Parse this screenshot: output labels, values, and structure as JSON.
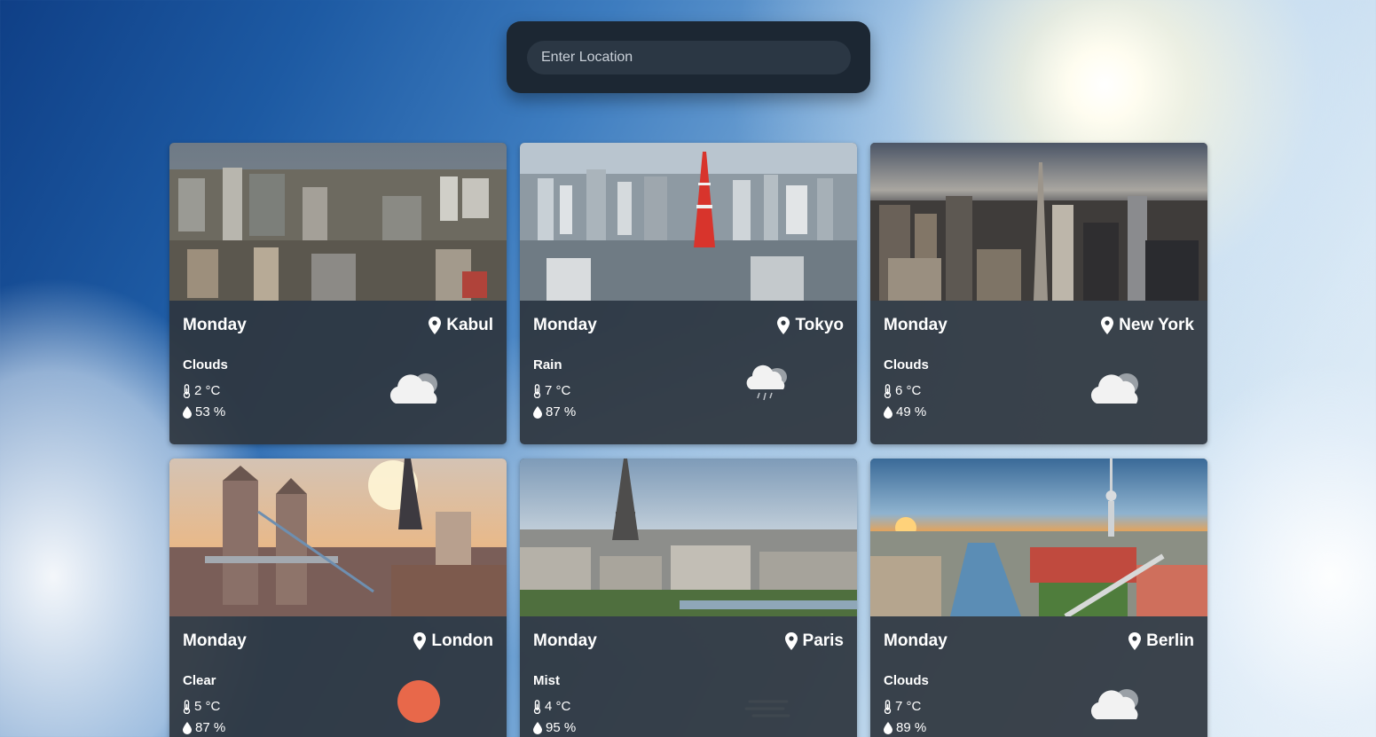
{
  "search": {
    "placeholder": "Enter Location"
  },
  "colors": {
    "panel": "#1c2733",
    "card": "#2e363e",
    "sun": "#e8684a"
  },
  "cards": [
    {
      "day": "Monday",
      "city": "Kabul",
      "condition": "Clouds",
      "temp": "2 °C",
      "humidity": "53 %",
      "icon": "cloud-icon"
    },
    {
      "day": "Monday",
      "city": "Tokyo",
      "condition": "Rain",
      "temp": "7 °C",
      "humidity": "87 %",
      "icon": "rain-cloud-icon"
    },
    {
      "day": "Monday",
      "city": "New York",
      "condition": "Clouds",
      "temp": "6 °C",
      "humidity": "49 %",
      "icon": "cloud-icon"
    },
    {
      "day": "Monday",
      "city": "London",
      "condition": "Clear",
      "temp": "5 °C",
      "humidity": "87 %",
      "icon": "sun-icon"
    },
    {
      "day": "Monday",
      "city": "Paris",
      "condition": "Mist",
      "temp": "4 °C",
      "humidity": "95 %",
      "icon": "mist-icon"
    },
    {
      "day": "Monday",
      "city": "Berlin",
      "condition": "Clouds",
      "temp": "7 °C",
      "humidity": "89 %",
      "icon": "cloud-icon"
    }
  ]
}
